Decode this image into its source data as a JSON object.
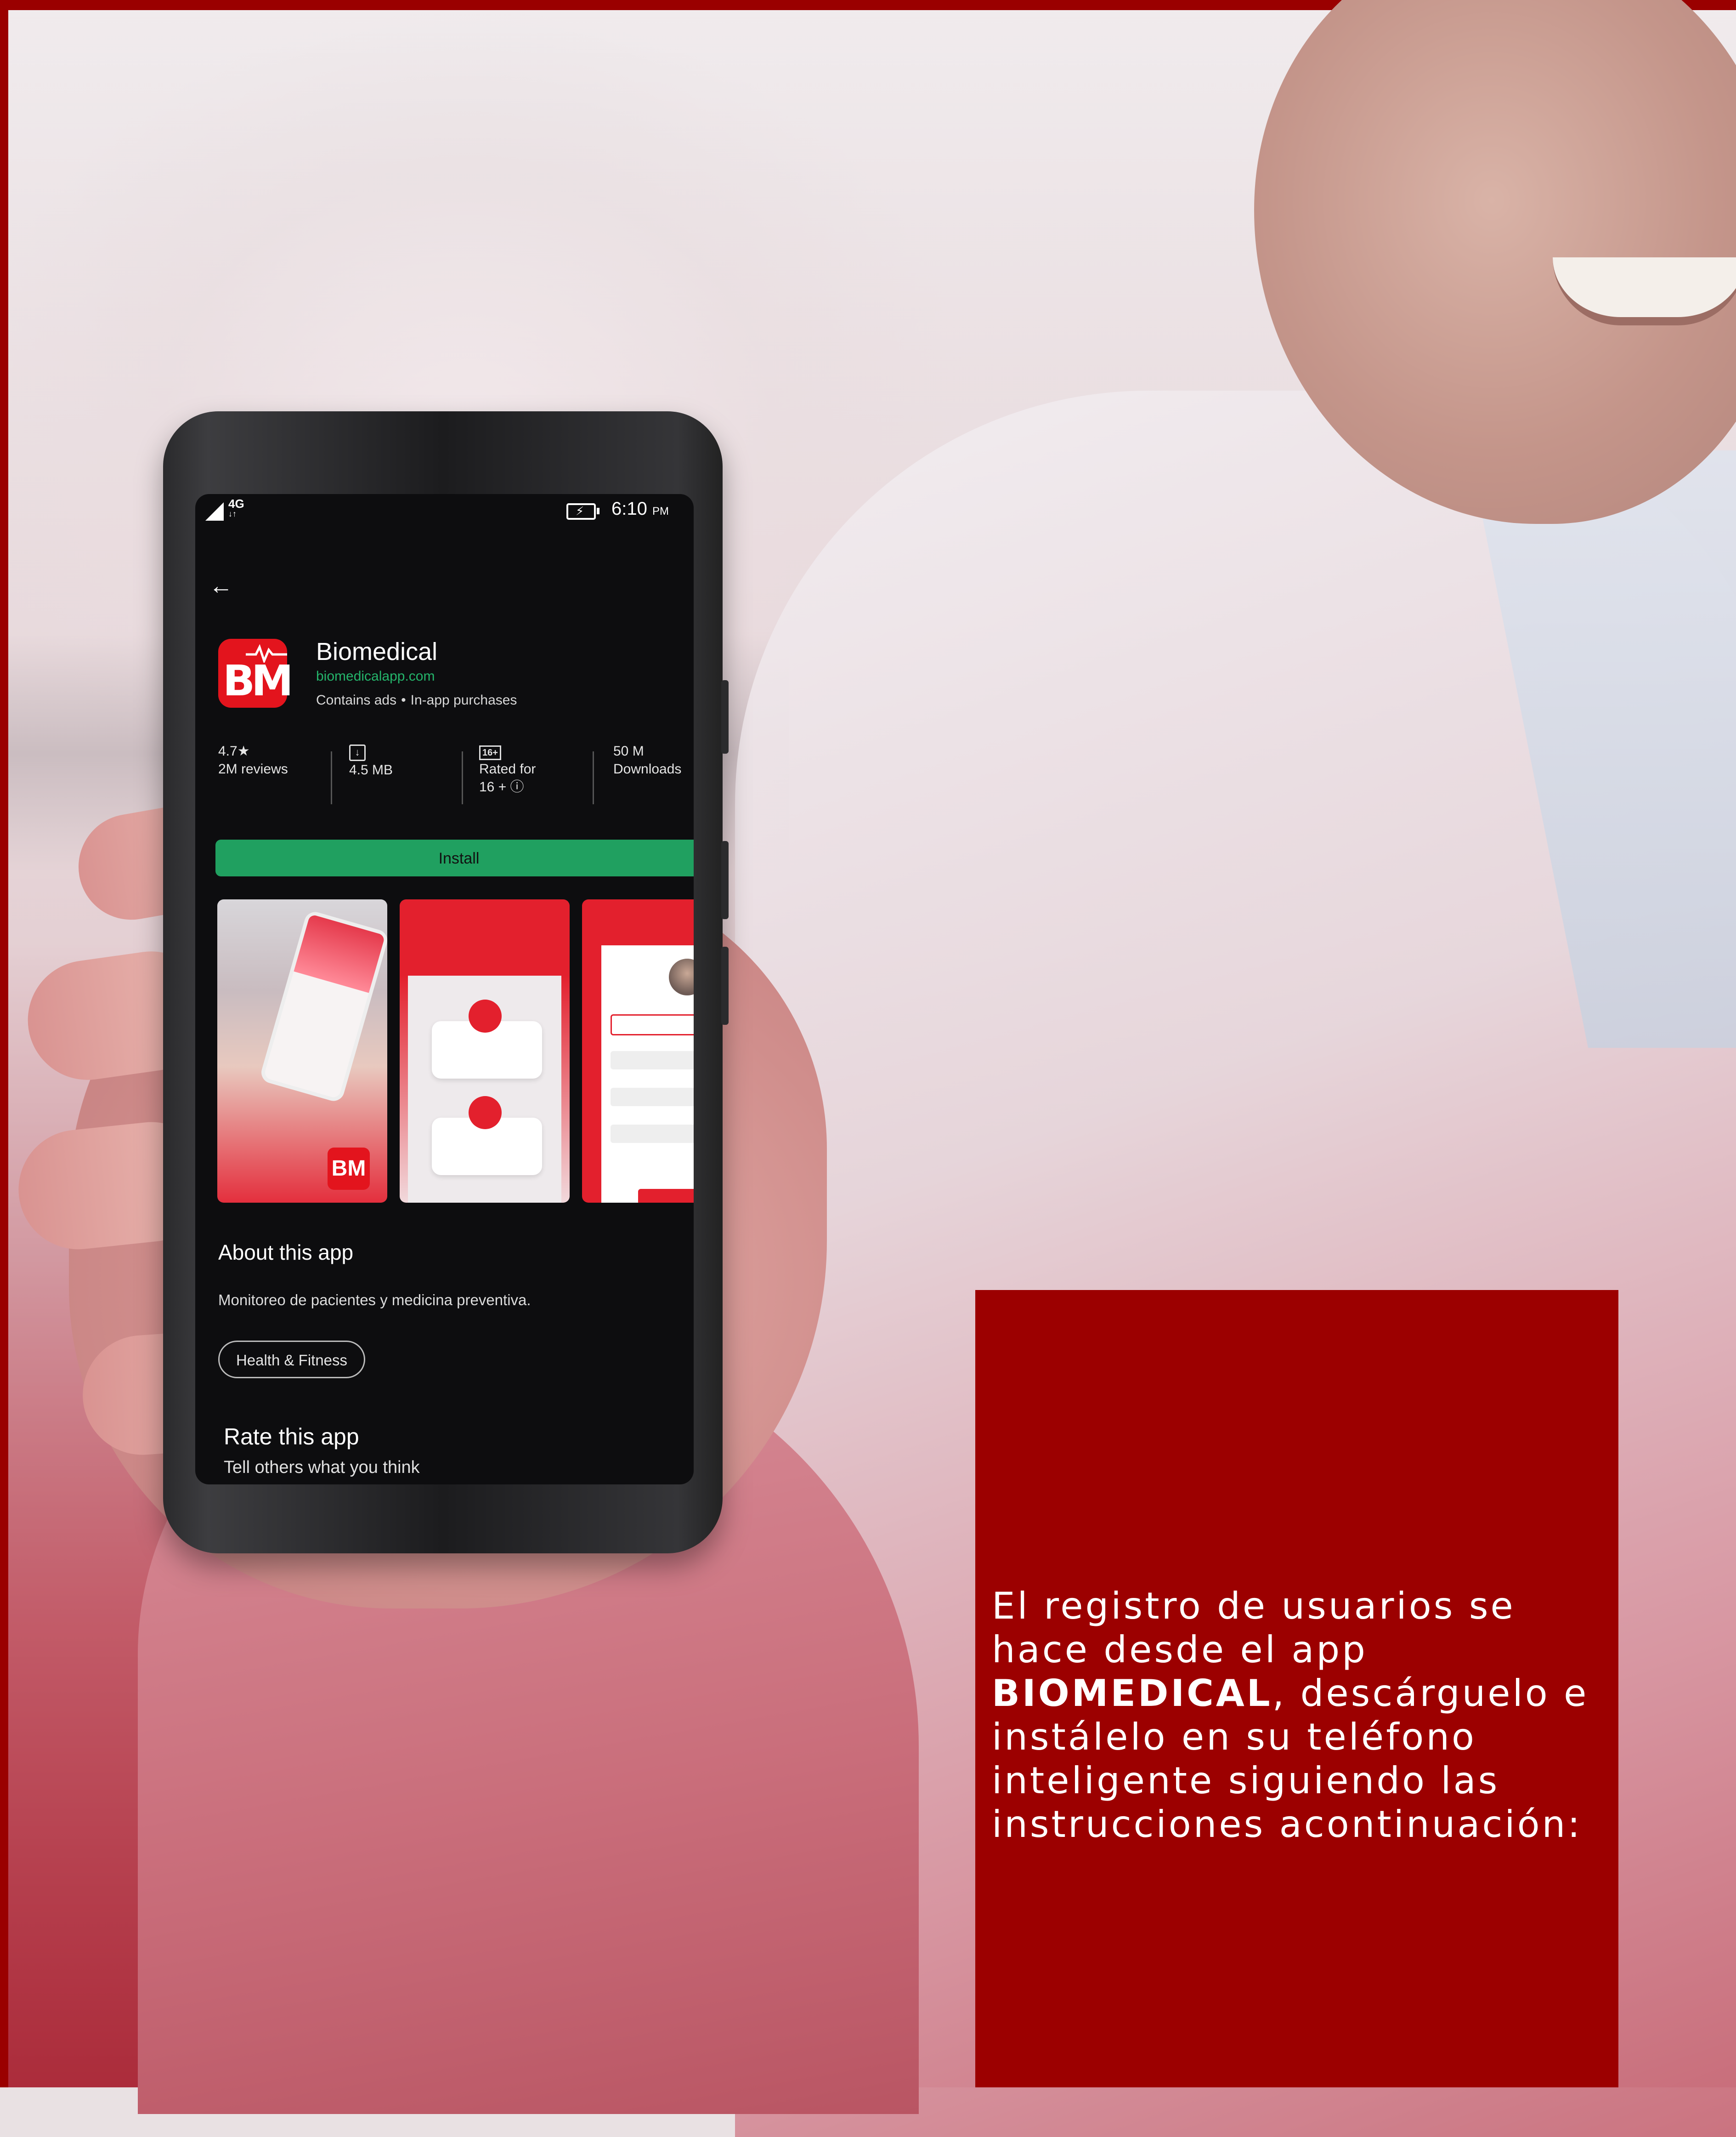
{
  "statusbar": {
    "network": "4G",
    "time": "6:10",
    "ampm": "PM"
  },
  "app": {
    "name": "Biomedical",
    "website": "biomedicalapp.com",
    "contains_ads": "Contains ads",
    "separator": "•",
    "in_app": "In-app purchases",
    "icon_text": "BM"
  },
  "stats": {
    "rating": "4.7★",
    "reviews": "2M reviews",
    "size": "4.5 MB",
    "rated_badge": "16+",
    "rated_line1": "Rated for",
    "rated_line2": "16 + ⓘ",
    "downloads_value": "50 M",
    "downloads_label": "Downloads"
  },
  "install_label": "Install",
  "about": {
    "title": "About this app",
    "description": "Monitoreo de pacientes y medicina preventiva.",
    "category": "Health & Fitness"
  },
  "rate": {
    "title": "Rate this app",
    "subtitle": "Tell others what you think"
  },
  "info": {
    "part1": "El registro de usuarios se hace desde el app ",
    "brand": "BIOMEDICAL",
    "part2": ", descárguelo e instálelo en su teléfono inteligente siguiendo las instrucciones acontinuación:"
  },
  "colors": {
    "brand_red": "#9c0000",
    "install_green": "#20a060",
    "icon_red": "#e3141d",
    "link_green": "#24b56b"
  }
}
